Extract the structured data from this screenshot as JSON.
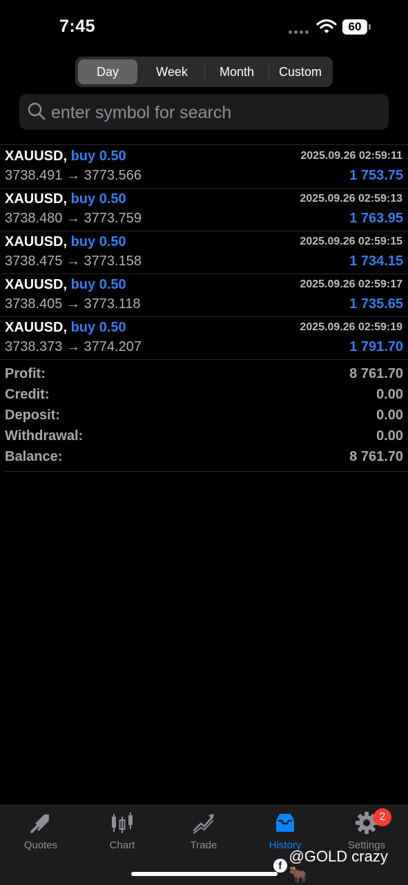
{
  "status": {
    "time": "7:45",
    "battery": "60"
  },
  "segments": [
    {
      "label": "Day",
      "active": true
    },
    {
      "label": "Week"
    },
    {
      "label": "Month"
    },
    {
      "label": "Custom"
    }
  ],
  "search": {
    "placeholder": "enter symbol for search"
  },
  "trades": [
    {
      "symbol": "XAUUSD,",
      "side": "buy 0.50",
      "time": "2025.09.26 02:59:11",
      "prices": "3738.491 → 3773.566",
      "profit": "1 753.75"
    },
    {
      "symbol": "XAUUSD,",
      "side": "buy 0.50",
      "time": "2025.09.26 02:59:13",
      "prices": "3738.480 → 3773.759",
      "profit": "1 763.95"
    },
    {
      "symbol": "XAUUSD,",
      "side": "buy 0.50",
      "time": "2025.09.26 02:59:15",
      "prices": "3738.475 → 3773.158",
      "profit": "1 734.15"
    },
    {
      "symbol": "XAUUSD,",
      "side": "buy 0.50",
      "time": "2025.09.26 02:59:17",
      "prices": "3738.405 → 3773.118",
      "profit": "1 735.65"
    },
    {
      "symbol": "XAUUSD,",
      "side": "buy 0.50",
      "time": "2025.09.26 02:59:19",
      "prices": "3738.373 → 3774.207",
      "profit": "1 791.70"
    }
  ],
  "summary": [
    {
      "label": "Profit:",
      "value": "8 761.70"
    },
    {
      "label": "Credit:",
      "value": "0.00"
    },
    {
      "label": "Deposit:",
      "value": "0.00"
    },
    {
      "label": "Withdrawal:",
      "value": "0.00"
    },
    {
      "label": "Balance:",
      "value": "8 761.70"
    }
  ],
  "tabs": [
    {
      "label": "Quotes",
      "icon": "quotes-icon"
    },
    {
      "label": "Chart",
      "icon": "chart-icon"
    },
    {
      "label": "Trade",
      "icon": "trade-icon"
    },
    {
      "label": "History",
      "icon": "history-icon",
      "active": true
    },
    {
      "label": "Settings",
      "icon": "settings-icon",
      "badge": "2"
    }
  ],
  "watermark": "@GOLD crazy 🐂",
  "colors": {
    "accent": "#0a84ff",
    "profit": "#2f7ff0",
    "badge": "#ff3b30"
  }
}
